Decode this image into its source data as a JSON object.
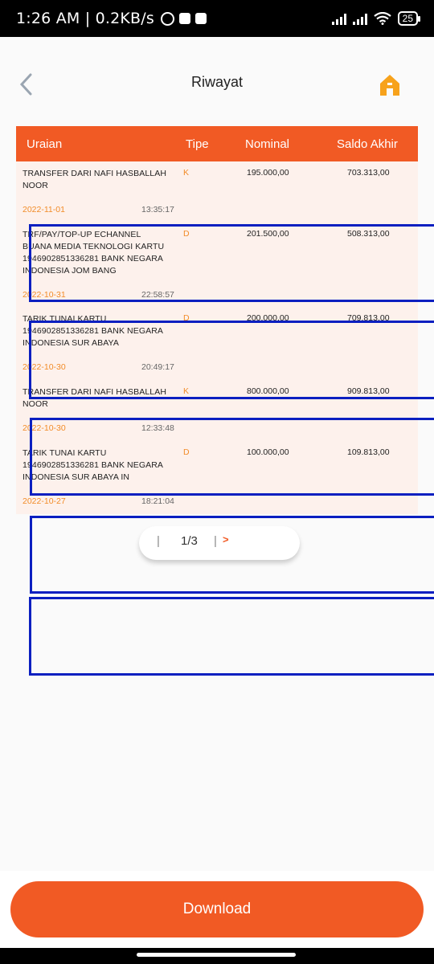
{
  "status_bar": {
    "time": "1:26 AM | 0.2KB/s",
    "battery": "25"
  },
  "header": {
    "title": "Riwayat",
    "back_icon": "chevron-left-icon",
    "home_icon": "home-icon"
  },
  "colors": {
    "accent": "#f15a24",
    "date_text": "#f28c28",
    "table_bg": "#fdf1ec",
    "highlight": "#0b1fc0"
  },
  "table": {
    "headers": {
      "uraian": "Uraian",
      "tipe": "Tipe",
      "nominal": "Nominal",
      "saldo": "Saldo Akhir"
    },
    "rows": [
      {
        "desc_lines": [
          "TRANSFER DARI NAFI HASBALLAH",
          "NOOR"
        ],
        "tipe": "K",
        "nominal": "195.000,00",
        "saldo": "703.313,00",
        "date": "2022-11-01",
        "time": "13:35:17"
      },
      {
        "desc_lines": [
          "TRF/PAY/TOP-UP ECHANNEL",
          "BUANA MEDIA TEKNOLOGI KARTU",
          "1946902851336281 BANK NEGARA",
          "INDONESIA JOM BANG"
        ],
        "tipe": "D",
        "nominal": "201.500,00",
        "saldo": "508.313,00",
        "date": "2022-10-31",
        "time": "22:58:57"
      },
      {
        "desc_lines": [
          "TARIK TUNAI KARTU",
          "1946902851336281 BANK NEGARA",
          "INDONESIA SUR ABAYA"
        ],
        "tipe": "D",
        "nominal": "200.000,00",
        "saldo": "709.813,00",
        "date": "2022-10-30",
        "time": "20:49:17"
      },
      {
        "desc_lines": [
          "TRANSFER DARI NAFI HASBALLAH",
          "NOOR"
        ],
        "tipe": "K",
        "nominal": "800.000,00",
        "saldo": "909.813,00",
        "date": "2022-10-30",
        "time": "12:33:48"
      },
      {
        "desc_lines": [
          "TARIK TUNAI KARTU",
          "1946902851336281 BANK NEGARA",
          "INDONESIA SUR ABAYA IN"
        ],
        "tipe": "D",
        "nominal": "100.000,00",
        "saldo": "109.813,00",
        "date": "2022-10-27",
        "time": "18:21:04"
      }
    ]
  },
  "pagination": {
    "separator": "|",
    "page": "1/3",
    "next": ">"
  },
  "download": {
    "label": "Download"
  }
}
